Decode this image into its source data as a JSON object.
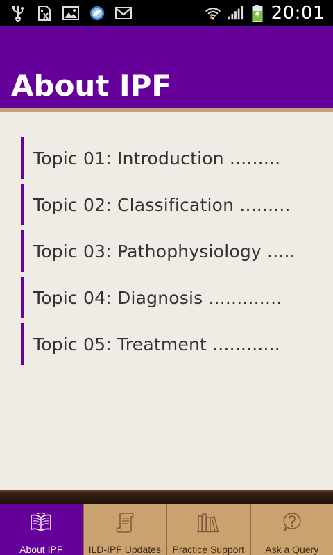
{
  "status_bar": {
    "time": "20:01",
    "icons": [
      "usb-icon",
      "sim-icon",
      "gallery-icon",
      "browser-icon",
      "gmail-icon",
      "wifi-icon",
      "signal-icon",
      "battery-charging-icon"
    ]
  },
  "header": {
    "title": "About IPF",
    "background_color": "#66009a",
    "accent_rule_color": "#c6a07c"
  },
  "topics": [
    {
      "label": "Topic 01: Introduction ........."
    },
    {
      "label": "Topic 02: Classification ........."
    },
    {
      "label": "Topic 03: Pathophysiology ....."
    },
    {
      "label": "Topic 04: Diagnosis ............."
    },
    {
      "label": "Topic 05: Treatment ............"
    }
  ],
  "tabs": [
    {
      "label": "About IPF",
      "icon": "open-book-icon",
      "active": true
    },
    {
      "label": "ILD-IPF Updates",
      "icon": "scroll-icon",
      "active": false
    },
    {
      "label": "Practice Support",
      "icon": "books-icon",
      "active": false
    },
    {
      "label": "Ask a Query",
      "icon": "question-bubble-icon",
      "active": false
    }
  ],
  "colors": {
    "tab_inactive": "#c9a26f",
    "tab_active": "#66009a",
    "page_background": "#efece6"
  }
}
